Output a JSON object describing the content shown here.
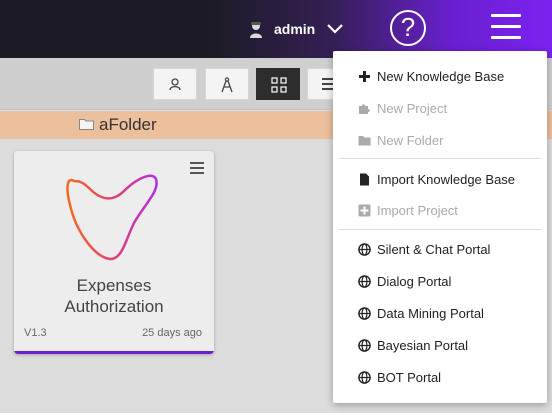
{
  "header": {
    "user_name": "admin",
    "help_symbol": "?"
  },
  "toolbar": {
    "views": [
      {
        "icon": "person-icon",
        "active": false
      },
      {
        "icon": "compass-icon",
        "active": false
      },
      {
        "icon": "grid-icon",
        "active": true
      },
      {
        "icon": "list-icon",
        "active": false
      }
    ]
  },
  "folder": {
    "name": "aFolder"
  },
  "project_card": {
    "title_line1": "Expenses",
    "title_line2": "Authorization",
    "version": "V1.3",
    "age": "25 days ago",
    "accent_color": "#6a1fd0"
  },
  "menu": {
    "items": [
      {
        "label": "New Knowledge Base",
        "icon": "plus-icon",
        "enabled": true
      },
      {
        "label": "New Project",
        "icon": "puzzle-icon",
        "enabled": false
      },
      {
        "label": "New Folder",
        "icon": "folder-icon",
        "enabled": false
      },
      {
        "label": "Import Knowledge Base",
        "icon": "file-icon",
        "enabled": true
      },
      {
        "label": "Import Project",
        "icon": "plus-square-icon",
        "enabled": false
      },
      {
        "label": "Silent & Chat Portal",
        "icon": "globe-icon",
        "enabled": true
      },
      {
        "label": "Dialog Portal",
        "icon": "globe-icon",
        "enabled": true
      },
      {
        "label": "Data Mining Portal",
        "icon": "globe-icon",
        "enabled": true
      },
      {
        "label": "Bayesian Portal",
        "icon": "globe-icon",
        "enabled": true
      },
      {
        "label": "BOT Portal",
        "icon": "globe-icon",
        "enabled": true
      }
    ]
  }
}
